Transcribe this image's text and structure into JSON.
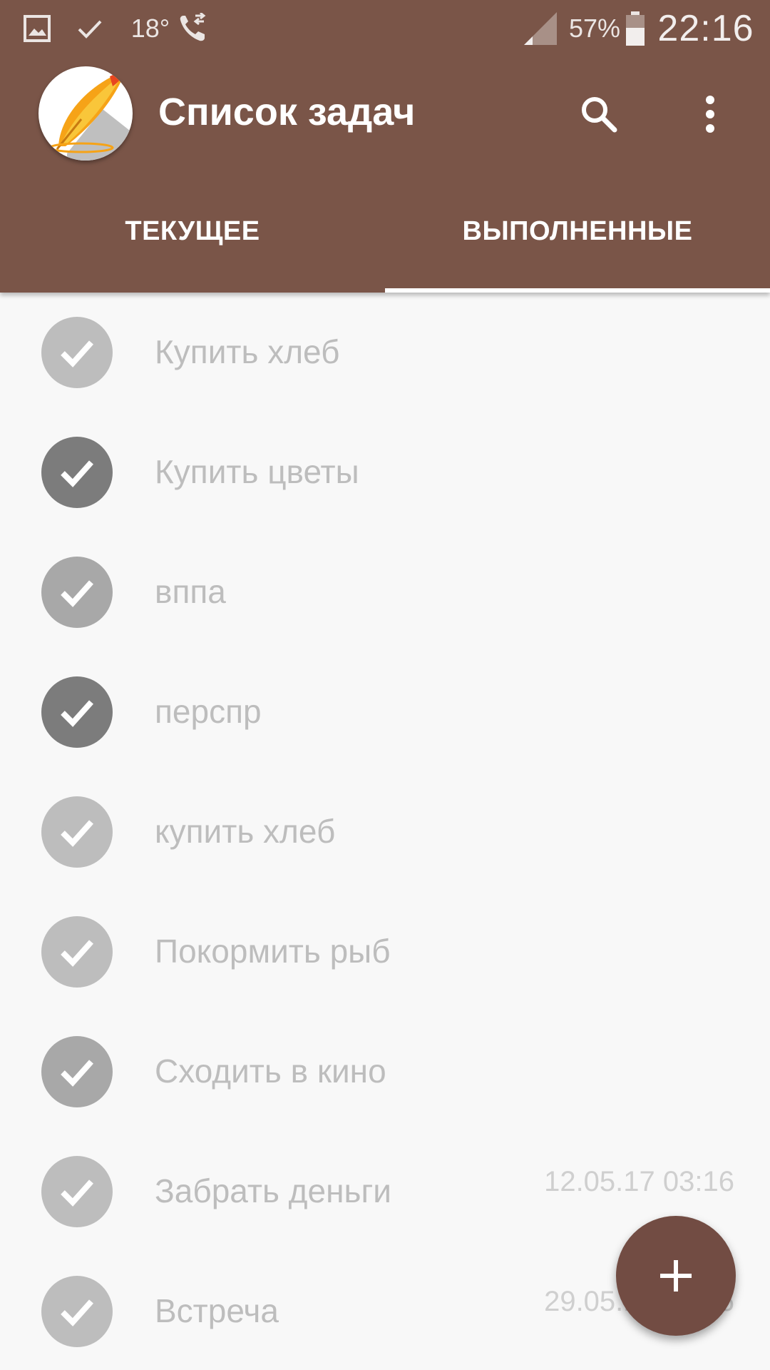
{
  "status_bar": {
    "temperature": "18°",
    "battery_percent": "57%",
    "clock": "22:16",
    "icons": [
      "gallery-icon",
      "check-icon",
      "call-forward-icon",
      "signal-icon",
      "battery-icon"
    ]
  },
  "app_bar": {
    "title": "Список задач",
    "logo_icon": "quill-logo-icon",
    "actions": [
      "search-icon",
      "more-vert-icon"
    ]
  },
  "tabs": [
    {
      "label": "ТЕКУЩЕЕ",
      "selected": false
    },
    {
      "label": "ВЫПОЛНЕННЫЕ",
      "selected": true
    }
  ],
  "tasks": [
    {
      "label": "Купить хлеб",
      "date": ""
    },
    {
      "label": "Купить цветы",
      "date": ""
    },
    {
      "label": "вппа",
      "date": ""
    },
    {
      "label": "перспр",
      "date": ""
    },
    {
      "label": "купить хлеб",
      "date": ""
    },
    {
      "label": "Покормить рыб",
      "date": ""
    },
    {
      "label": "Сходить в кино",
      "date": ""
    },
    {
      "label": "Забрать деньги",
      "date": "12.05.17 03:16"
    },
    {
      "label": "Встреча",
      "date": "29.05.17 03:16"
    }
  ],
  "colors": {
    "primary": "#7a5548",
    "fab": "#724c43",
    "background": "#f8f8f8",
    "check_light": "#bdbdbd",
    "check_dark": "#7c7c7c",
    "text_muted": "#bdbdbd"
  },
  "fab": {
    "icon": "plus-icon"
  }
}
